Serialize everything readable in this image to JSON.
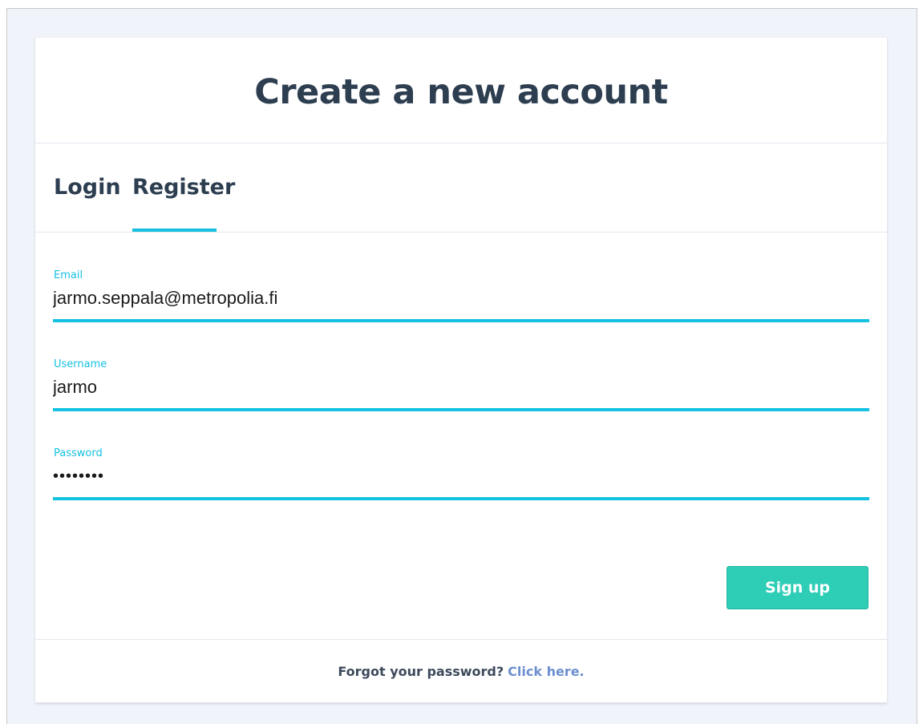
{
  "header": {
    "title": "Create a new account"
  },
  "tabs": [
    {
      "label": "Login",
      "active": false
    },
    {
      "label": "Register",
      "active": true
    }
  ],
  "form": {
    "email": {
      "label": "Email",
      "value": "jarmo.seppala@metropolia.fi"
    },
    "username": {
      "label": "Username",
      "value": "jarmo"
    },
    "password": {
      "label": "Password",
      "value": "••••••••"
    },
    "submit_label": "Sign up"
  },
  "footer": {
    "prompt": "Forgot your password?",
    "link_text": "Click here."
  },
  "colors": {
    "accent": "#15c1e1",
    "button": "#2dcdb6",
    "link": "#6d8fcf",
    "title": "#2d3e50",
    "background": "#f0f3fa"
  }
}
